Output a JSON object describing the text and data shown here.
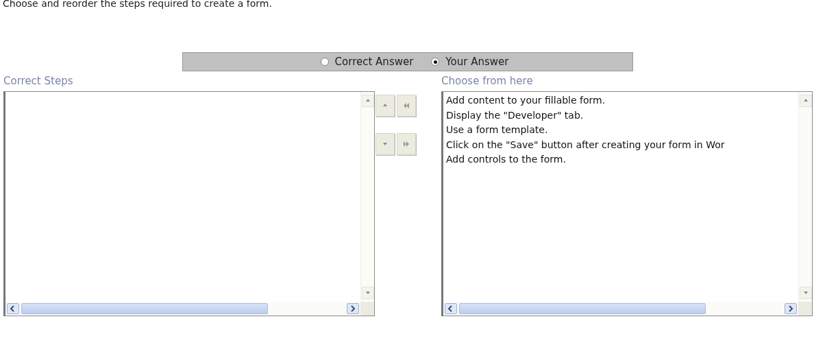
{
  "instruction": "Choose and reorder the steps required to create a form.",
  "answer_toggle": [
    {
      "label": "Correct Answer",
      "selected": false
    },
    {
      "label": "Your Answer",
      "selected": true
    }
  ],
  "correct_steps": {
    "label": "Correct Steps"
  },
  "choose_from": {
    "label": "Choose from here",
    "items": [
      "Add content to your fillable form.",
      "Display the \"Developer\" tab.",
      "Use a form template.",
      "Click on the \"Save\" button after creating your form in Wor",
      "Add controls to the form."
    ]
  }
}
